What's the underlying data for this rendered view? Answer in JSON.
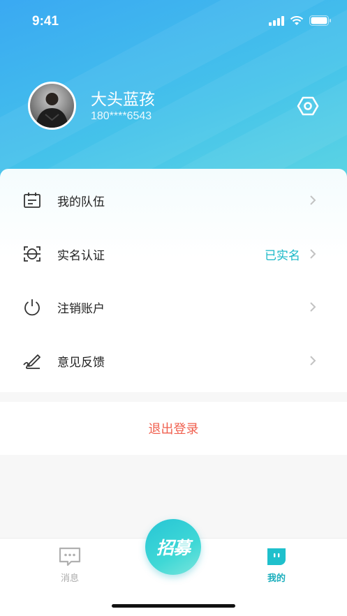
{
  "status_bar": {
    "time": "9:41"
  },
  "profile": {
    "name": "大头蓝孩",
    "phone": "180****6543",
    "avatar_icon": "user-avatar-photo",
    "settings_icon": "hexagon-settings-icon"
  },
  "menu": {
    "items": [
      {
        "label": "我的队伍",
        "icon": "team-calendar-icon",
        "value": ""
      },
      {
        "label": "实名认证",
        "icon": "face-scan-icon",
        "value": "已实名"
      },
      {
        "label": "注销账户",
        "icon": "power-icon",
        "value": ""
      },
      {
        "label": "意见反馈",
        "icon": "pen-feedback-icon",
        "value": ""
      }
    ]
  },
  "logout": {
    "label": "退出登录"
  },
  "tab_bar": {
    "messages": {
      "label": "消息"
    },
    "recruit": {
      "label": "招募"
    },
    "mine": {
      "label": "我的"
    }
  },
  "colors": {
    "header_gradient_start": "#3aa9f2",
    "header_gradient_end": "#5fd7e2",
    "accent": "#19b8c7",
    "logout_red": "#f0604f"
  }
}
